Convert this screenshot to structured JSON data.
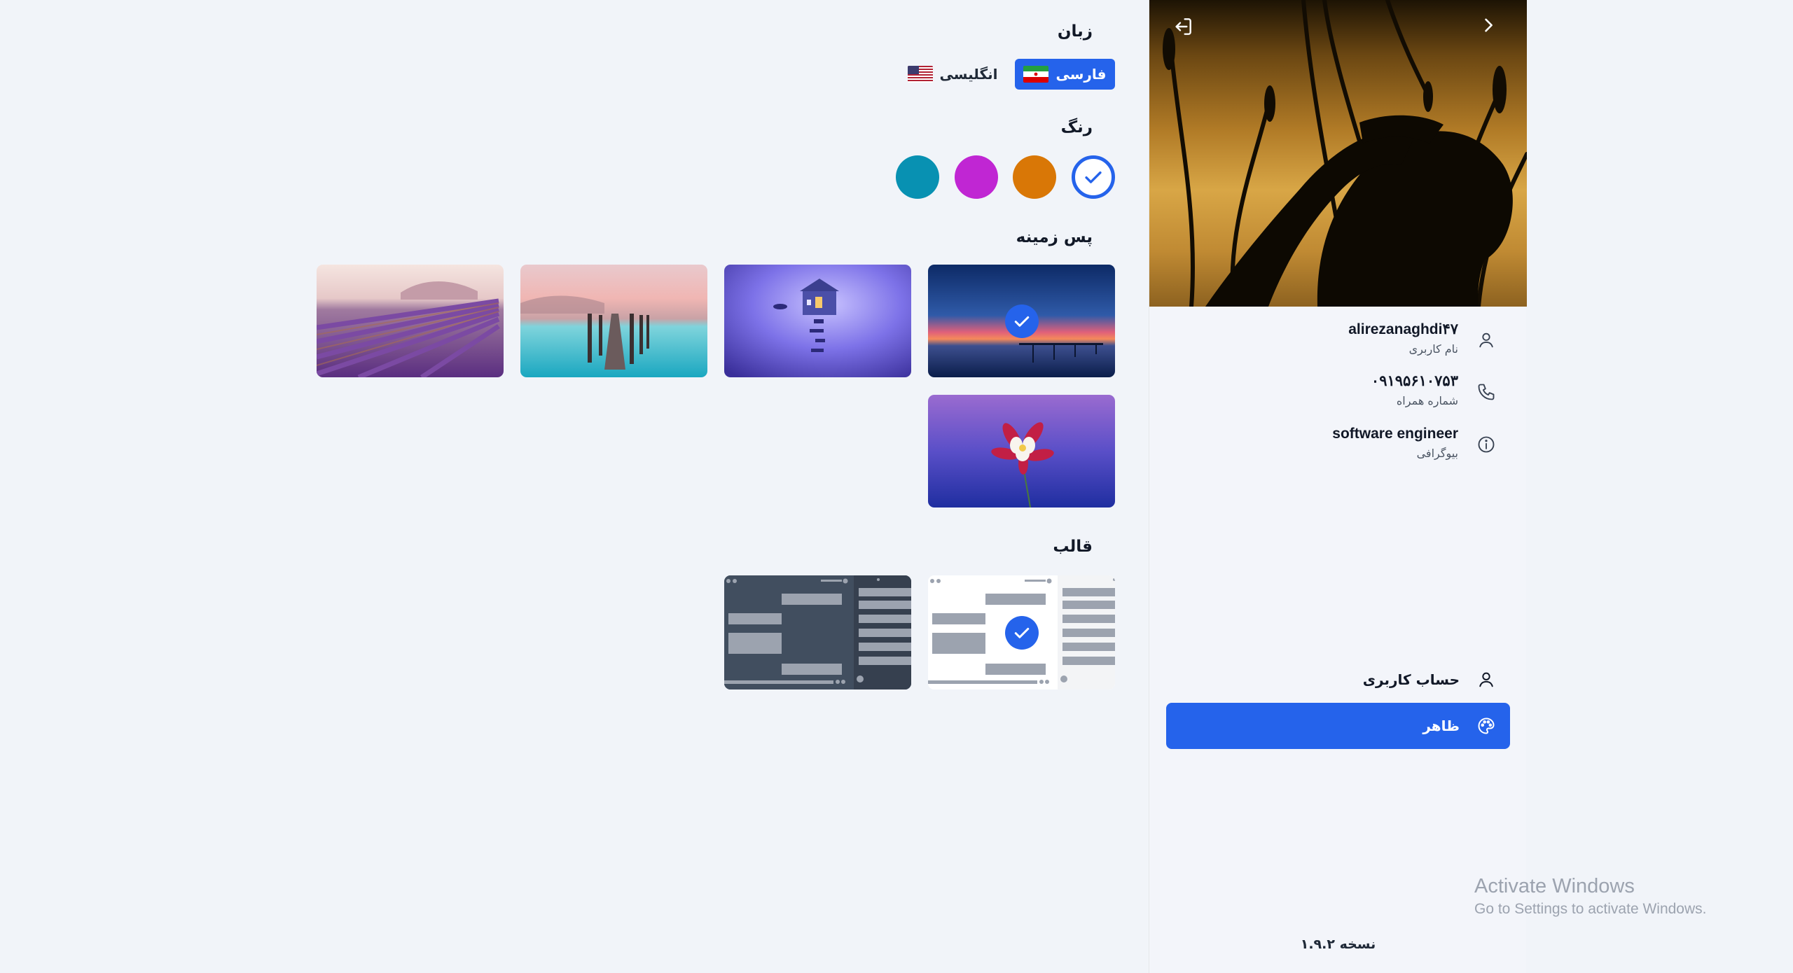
{
  "profile": {
    "username_value": "alirezanaghdi۴۷",
    "username_caption": "نام کاربری",
    "phone_value": "۰۹۱۹۵۶۱۰۷۵۳",
    "phone_caption": "شماره همراه",
    "bio_value": "software engineer",
    "bio_caption": "بیوگرافی"
  },
  "menu": {
    "account_label": "حساب کاربری",
    "appearance_label": "ظاهر"
  },
  "version_label": "نسخه ۱.۹.۲",
  "settings": {
    "language_title": "زبان",
    "language_options": [
      "فارسی",
      "انگلیسی"
    ],
    "language_selected": "فارسی",
    "color_title": "رنگ",
    "colors": [
      "#2563eb",
      "#d97706",
      "#c026d3",
      "#0891b2"
    ],
    "color_selected": "#2563eb",
    "background_title": "پس زمینه",
    "backgrounds": [
      "pier-sunset",
      "house-on-water",
      "lake-pier",
      "lavender-field",
      "flower"
    ],
    "background_selected": "pier-sunset",
    "template_title": "قالب",
    "templates": [
      "light",
      "dark"
    ],
    "template_selected": "light"
  },
  "watermark": {
    "line1": "Activate Windows",
    "line2": "Go to Settings to activate Windows."
  },
  "icons": {
    "logout": "logout-icon",
    "back": "chevron-right-icon",
    "user": "user-icon",
    "phone": "phone-icon",
    "info": "info-icon",
    "palette": "palette-icon",
    "check": "check-icon"
  }
}
